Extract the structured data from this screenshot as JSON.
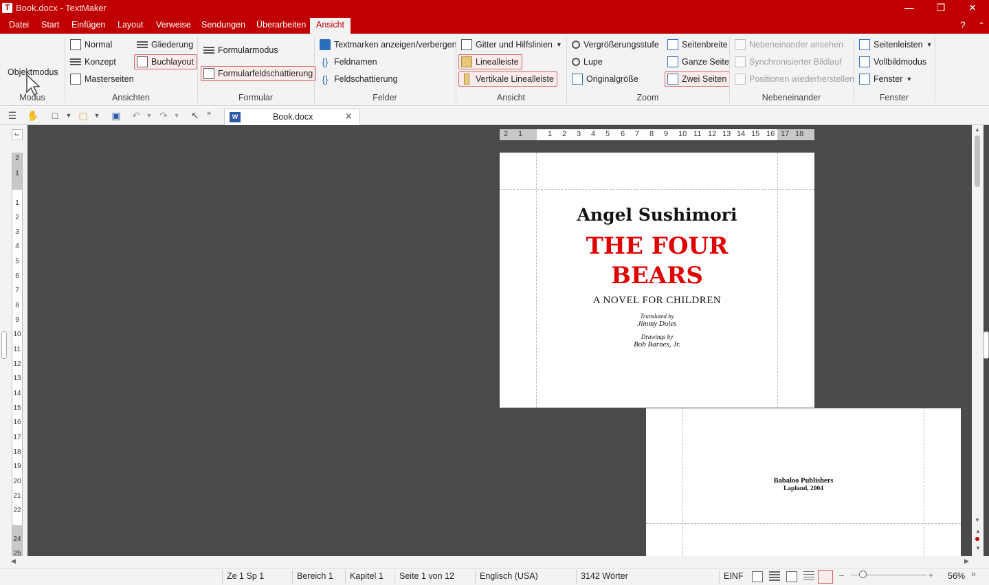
{
  "window": {
    "title": "Book.docx - TextMaker",
    "app_letter": "T"
  },
  "menu": [
    "Datei",
    "Start",
    "Einfügen",
    "Layout",
    "Verweise",
    "Sendungen",
    "Überarbeiten",
    "Ansicht"
  ],
  "ribbon": {
    "modus": {
      "objektmodus": "Objektmodus"
    },
    "ansichten": {
      "normal": "Normal",
      "konzept": "Konzept",
      "masterseiten": "Masterseiten",
      "gliederung": "Gliederung",
      "buchlayout": "Buchlayout"
    },
    "formular": {
      "formularmodus": "Formularmodus",
      "formularfeldschattierung": "Formularfeldschattierung"
    },
    "felder": {
      "textmarken": "Textmarken anzeigen/verbergen",
      "feldnamen": "Feldnamen",
      "feldschattierung": "Feldschattierung"
    },
    "ansicht": {
      "gitter": "Gitter und Hilfslinien",
      "linealleiste": "Linealleiste",
      "vertikale": "Vertikale Linealleiste"
    },
    "zoom": {
      "vergroesserung": "Vergrößerungsstufe",
      "lupe": "Lupe",
      "originalgroesse": "Originalgröße",
      "seitenbreite": "Seitenbreite",
      "ganze_seite": "Ganze Seite",
      "zwei_seiten": "Zwei Seiten"
    },
    "nebeneinander": {
      "ansehen": "Nebeneinander ansehen",
      "sync": "Synchronisierter Bildlauf",
      "positionen": "Positionen wiederherstellen"
    },
    "fenster": {
      "seitenleisten": "Seitenleisten",
      "vollbild": "Vollbildmodus",
      "fenster": "Fenster"
    },
    "groups": {
      "modus": "Modus",
      "ansichten": "Ansichten",
      "formular": "Formular",
      "felder": "Felder",
      "ansicht": "Ansicht",
      "zoom": "Zoom",
      "nebeneinander": "Nebeneinander",
      "fenster": "Fenster"
    }
  },
  "document_tab": {
    "name": "Book.docx",
    "icon_letter": "W"
  },
  "hruler": [
    "2",
    "1",
    "1",
    "2",
    "3",
    "4",
    "5",
    "6",
    "7",
    "8",
    "9",
    "10",
    "11",
    "12",
    "13",
    "14",
    "15",
    "16",
    "17",
    "18"
  ],
  "vruler": [
    "2",
    "1",
    "1",
    "2",
    "3",
    "4",
    "5",
    "6",
    "7",
    "8",
    "9",
    "10",
    "11",
    "12",
    "13",
    "14",
    "15",
    "16",
    "17",
    "18",
    "19",
    "20",
    "21",
    "22",
    "24",
    "25"
  ],
  "page1": {
    "author": "Angel Sushimori",
    "title_line1": "THE FOUR",
    "title_line2": "BEARS",
    "subtitle": "A NOVEL FOR CHILDREN",
    "translated_label": "Translated by",
    "translator": "Jimmy Doles",
    "drawings_label": "Drawings by",
    "illustrator": "Bob Barnes, Jr."
  },
  "page2": {
    "publisher": "Babaloo Publishers",
    "place_year": "Lapland, 2004"
  },
  "status": {
    "position": "Ze 1 Sp 1",
    "bereich": "Bereich 1",
    "kapitel": "Kapitel 1",
    "seite": "Seite 1 von 12",
    "sprache": "Englisch (USA)",
    "woerter": "3142 Wörter",
    "modus": "EINF",
    "zoom": "56%"
  },
  "colors": {
    "accent": "#c00000",
    "title_red": "#e00000"
  }
}
